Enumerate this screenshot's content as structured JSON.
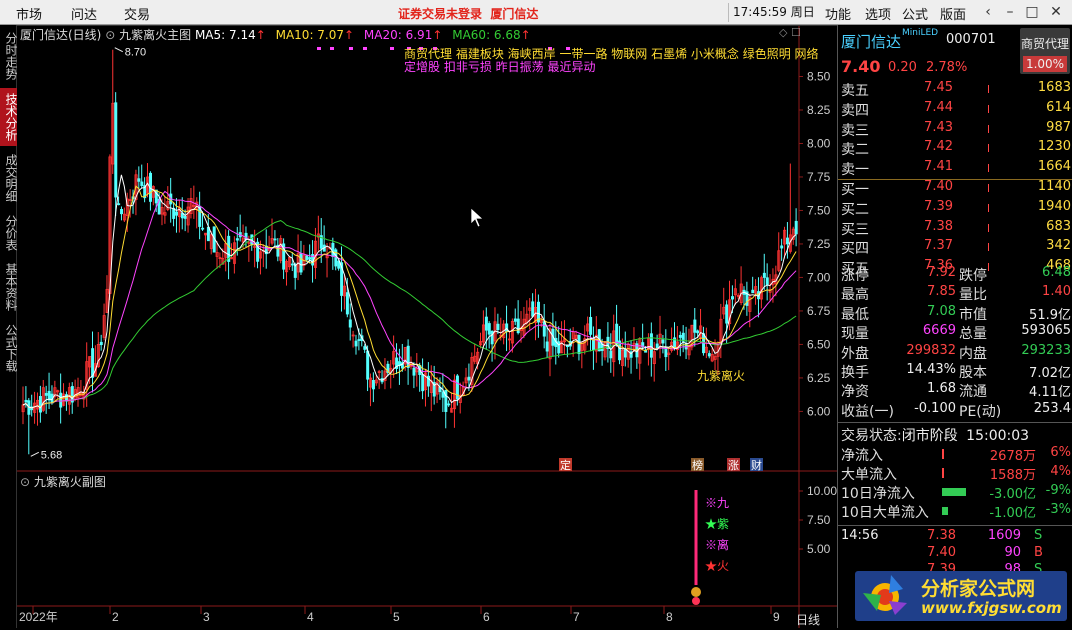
{
  "menu": {
    "market": "市场",
    "wenda": "问达",
    "trade": "交易",
    "alert": "证券交易未登录",
    "alert2": "厦门信达",
    "time": "17:45:59",
    "weekday": "周日",
    "func": "功能",
    "opts": "选项",
    "formula": "公式",
    "layout": "版面"
  },
  "side_tabs": [
    "分时走势",
    "技术分析",
    "成交明细",
    "分价表",
    "基本资料",
    "公式下载"
  ],
  "chart": {
    "stock_title": "厦门信达(日线)",
    "main_formula": "九紫离火主图",
    "ma5": "MA5: 7.14",
    "ma10": "MA10: 7.07",
    "ma20": "MA20: 6.91",
    "ma60": "MA60: 6.68",
    "concepts1": "商贸代理 福建板块 海峡西岸 一带一路 物联网 石墨烯 小米概念 绿色照明 网络",
    "concepts2": "定增股 扣非亏损 昨日振荡 最近异动",
    "high_label": "8.70",
    "low_label": "5.68",
    "signal_label": "九紫离火",
    "sub_title": "九紫离火副图",
    "period": "日线",
    "year_label": "2022年",
    "months": [
      "2",
      "3",
      "4",
      "5",
      "6",
      "7",
      "8",
      "9"
    ],
    "price_ticks": [
      "8.50",
      "8.25",
      "8.00",
      "7.75",
      "7.50",
      "7.25",
      "7.00",
      "6.75",
      "6.50",
      "6.25",
      "6.00"
    ],
    "sub_ticks": [
      "10.00",
      "7.50",
      "5.00"
    ],
    "event_badges": [
      "定",
      "榜",
      "涨",
      "财"
    ],
    "legend": [
      {
        "sym": "※",
        "text": "九",
        "color": "#ff44ff"
      },
      {
        "sym": "★",
        "text": "紫",
        "color": "#33ff55"
      },
      {
        "sym": "※",
        "text": "离",
        "color": "#ff44ff"
      },
      {
        "sym": "★",
        "text": "火",
        "color": "#ff3333"
      }
    ],
    "colors": {
      "up": "#ff3333",
      "down": "#54ffff",
      "ma5": "#ffffff",
      "ma10": "#ffdd33",
      "ma20": "#ff44ff",
      "ma60": "#33cc33"
    }
  },
  "chart_data": {
    "type": "candlestick",
    "ylim": [
      5.6,
      8.75
    ],
    "x_months": [
      "2022年",
      "2",
      "3",
      "4",
      "5",
      "6",
      "7",
      "8",
      "9"
    ],
    "ma_values": {
      "MA5": 7.14,
      "MA10": 7.07,
      "MA20": 6.91,
      "MA60": 6.68
    },
    "high": 8.7,
    "low": 5.68
  },
  "quote": {
    "name": "厦门信达",
    "miniled": "MiniLED",
    "code": "000701",
    "sector_label": "商贸代理",
    "sector_pct": "1.00%",
    "price": "7.40",
    "change": "0.20",
    "pct": "2.78%"
  },
  "sells": [
    {
      "label": "卖五",
      "price": "7.45",
      "vol": "1683"
    },
    {
      "label": "卖四",
      "price": "7.44",
      "vol": "614"
    },
    {
      "label": "卖三",
      "price": "7.43",
      "vol": "987"
    },
    {
      "label": "卖二",
      "price": "7.42",
      "vol": "1230"
    },
    {
      "label": "卖一",
      "price": "7.41",
      "vol": "1664"
    }
  ],
  "buys": [
    {
      "label": "买一",
      "price": "7.40",
      "vol": "1140"
    },
    {
      "label": "买二",
      "price": "7.39",
      "vol": "1940"
    },
    {
      "label": "买三",
      "price": "7.38",
      "vol": "683"
    },
    {
      "label": "买四",
      "price": "7.37",
      "vol": "342"
    },
    {
      "label": "买五",
      "price": "7.36",
      "vol": "468"
    }
  ],
  "stats": [
    {
      "l1": "涨停",
      "v1": "7.92",
      "c1": "red",
      "l2": "跌停",
      "v2": "6.48",
      "c2": "green"
    },
    {
      "l1": "最高",
      "v1": "7.85",
      "c1": "red",
      "l2": "量比",
      "v2": "1.40",
      "c2": "red"
    },
    {
      "l1": "最低",
      "v1": "7.08",
      "c1": "green",
      "l2": "市值",
      "v2": "51.9亿",
      "c2": "white"
    },
    {
      "l1": "现量",
      "v1": "6669",
      "c1": "mag",
      "l2": "总量",
      "v2": "593065",
      "c2": "white"
    },
    {
      "l1": "外盘",
      "v1": "299832",
      "c1": "red",
      "l2": "内盘",
      "v2": "293233",
      "c2": "green"
    },
    {
      "l1": "换手",
      "v1": "14.43%",
      "c1": "white",
      "l2": "股本",
      "v2": "7.02亿",
      "c2": "white"
    },
    {
      "l1": "净资",
      "v1": "1.68",
      "c1": "white",
      "l2": "流通",
      "v2": "4.11亿",
      "c2": "white"
    },
    {
      "l1": "收益(一)",
      "v1": "-0.100",
      "c1": "white",
      "l2": "PE(动)",
      "v2": "253.4",
      "c2": "white"
    }
  ],
  "trade_state": {
    "label": "交易状态:",
    "value": "闭市阶段",
    "time": "15:00:03"
  },
  "flows": [
    {
      "l": "净流入",
      "v": "2678万",
      "p": "6%",
      "c": "red"
    },
    {
      "l": "大单流入",
      "v": "1588万",
      "p": "4%",
      "c": "red"
    },
    {
      "l": "10日净流入",
      "v": "-3.00亿",
      "p": "-9%",
      "c": "green"
    },
    {
      "l": "10日大单流入",
      "v": "-1.00亿",
      "p": "-3%",
      "c": "green"
    }
  ],
  "ticks": [
    {
      "t": "14:56",
      "p": "7.38",
      "v": "1609",
      "s": "S"
    },
    {
      "t": "",
      "p": "7.40",
      "v": "90",
      "s": "B"
    },
    {
      "t": "",
      "p": "7.39",
      "v": "98",
      "s": "S"
    }
  ],
  "logo_title": "分析家公式网",
  "logo_url": "www.fxjgsw.com"
}
